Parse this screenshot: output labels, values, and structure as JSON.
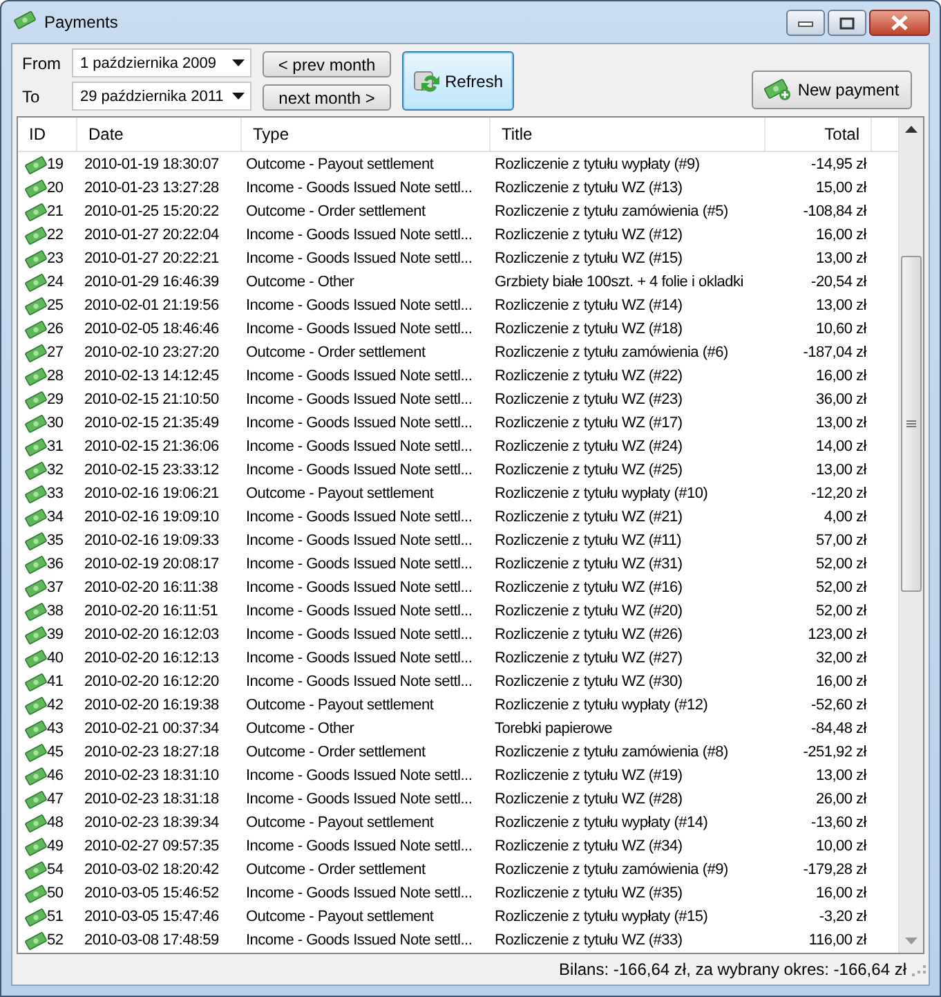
{
  "window": {
    "title": "Payments"
  },
  "filters": [
    {
      "label": "From",
      "value": "1 października 2009"
    },
    {
      "label": "To",
      "value": "29 października 2011"
    }
  ],
  "nav_buttons": [
    "< prev month",
    "next month >"
  ],
  "refresh_button": "Refresh",
  "new_payment_button": "New payment",
  "table": {
    "columns": [
      "ID",
      "Date",
      "Type",
      "Title",
      "Total"
    ],
    "rows": [
      [
        "19",
        "2010-01-19 18:30:07",
        "Outcome - Payout settlement",
        "Rozliczenie z tytułu wypłaty (#9)",
        "-14,95 zł"
      ],
      [
        "20",
        "2010-01-23 13:27:28",
        "Income - Goods Issued Note settl...",
        "Rozliczenie z tytułu WZ (#13)",
        "15,00 zł"
      ],
      [
        "21",
        "2010-01-25 15:20:22",
        "Outcome - Order settlement",
        "Rozliczenie z tytułu zamówienia (#5)",
        "-108,84 zł"
      ],
      [
        "22",
        "2010-01-27 20:22:04",
        "Income - Goods Issued Note settl...",
        "Rozliczenie z tytułu WZ (#12)",
        "16,00 zł"
      ],
      [
        "23",
        "2010-01-27 20:22:21",
        "Income - Goods Issued Note settl...",
        "Rozliczenie z tytułu WZ (#15)",
        "13,00 zł"
      ],
      [
        "24",
        "2010-01-29 16:46:39",
        "Outcome - Other",
        "Grzbiety białe 100szt. + 4 folie i okladki",
        "-20,54 zł"
      ],
      [
        "25",
        "2010-02-01 21:19:56",
        "Income - Goods Issued Note settl...",
        "Rozliczenie z tytułu WZ (#14)",
        "13,00 zł"
      ],
      [
        "26",
        "2010-02-05 18:46:46",
        "Income - Goods Issued Note settl...",
        "Rozliczenie z tytułu WZ (#18)",
        "10,60 zł"
      ],
      [
        "27",
        "2010-02-10 23:27:20",
        "Outcome - Order settlement",
        "Rozliczenie z tytułu zamówienia (#6)",
        "-187,04 zł"
      ],
      [
        "28",
        "2010-02-13 14:12:45",
        "Income - Goods Issued Note settl...",
        "Rozliczenie z tytułu WZ (#22)",
        "16,00 zł"
      ],
      [
        "29",
        "2010-02-15 21:10:50",
        "Income - Goods Issued Note settl...",
        "Rozliczenie z tytułu WZ (#23)",
        "36,00 zł"
      ],
      [
        "30",
        "2010-02-15 21:35:49",
        "Income - Goods Issued Note settl...",
        "Rozliczenie z tytułu WZ (#17)",
        "13,00 zł"
      ],
      [
        "31",
        "2010-02-15 21:36:06",
        "Income - Goods Issued Note settl...",
        "Rozliczenie z tytułu WZ (#24)",
        "14,00 zł"
      ],
      [
        "32",
        "2010-02-15 23:33:12",
        "Income - Goods Issued Note settl...",
        "Rozliczenie z tytułu WZ (#25)",
        "13,00 zł"
      ],
      [
        "33",
        "2010-02-16 19:06:21",
        "Outcome - Payout settlement",
        "Rozliczenie z tytułu wypłaty (#10)",
        "-12,20 zł"
      ],
      [
        "34",
        "2010-02-16 19:09:10",
        "Income - Goods Issued Note settl...",
        "Rozliczenie z tytułu WZ (#21)",
        "4,00 zł"
      ],
      [
        "35",
        "2010-02-16 19:09:33",
        "Income - Goods Issued Note settl...",
        "Rozliczenie z tytułu WZ (#11)",
        "57,00 zł"
      ],
      [
        "36",
        "2010-02-19 20:08:17",
        "Income - Goods Issued Note settl...",
        "Rozliczenie z tytułu WZ (#31)",
        "52,00 zł"
      ],
      [
        "37",
        "2010-02-20 16:11:38",
        "Income - Goods Issued Note settl...",
        "Rozliczenie z tytułu WZ (#16)",
        "52,00 zł"
      ],
      [
        "38",
        "2010-02-20 16:11:51",
        "Income - Goods Issued Note settl...",
        "Rozliczenie z tytułu WZ (#20)",
        "52,00 zł"
      ],
      [
        "39",
        "2010-02-20 16:12:03",
        "Income - Goods Issued Note settl...",
        "Rozliczenie z tytułu WZ (#26)",
        "123,00 zł"
      ],
      [
        "40",
        "2010-02-20 16:12:13",
        "Income - Goods Issued Note settl...",
        "Rozliczenie z tytułu WZ (#27)",
        "32,00 zł"
      ],
      [
        "41",
        "2010-02-20 16:12:20",
        "Income - Goods Issued Note settl...",
        "Rozliczenie z tytułu WZ (#30)",
        "16,00 zł"
      ],
      [
        "42",
        "2010-02-20 16:19:38",
        "Outcome - Payout settlement",
        "Rozliczenie z tytułu wypłaty (#12)",
        "-52,60 zł"
      ],
      [
        "43",
        "2010-02-21 00:37:34",
        "Outcome - Other",
        "Torebki papierowe",
        "-84,48 zł"
      ],
      [
        "45",
        "2010-02-23 18:27:18",
        "Outcome - Order settlement",
        "Rozliczenie z tytułu zamówienia (#8)",
        "-251,92 zł"
      ],
      [
        "46",
        "2010-02-23 18:31:10",
        "Income - Goods Issued Note settl...",
        "Rozliczenie z tytułu WZ (#19)",
        "13,00 zł"
      ],
      [
        "47",
        "2010-02-23 18:31:18",
        "Income - Goods Issued Note settl...",
        "Rozliczenie z tytułu WZ (#28)",
        "26,00 zł"
      ],
      [
        "48",
        "2010-02-23 18:39:34",
        "Outcome - Payout settlement",
        "Rozliczenie z tytułu wypłaty (#14)",
        "-13,60 zł"
      ],
      [
        "49",
        "2010-02-27 09:57:35",
        "Income - Goods Issued Note settl...",
        "Rozliczenie z tytułu WZ (#34)",
        "10,00 zł"
      ],
      [
        "54",
        "2010-03-02 18:20:42",
        "Outcome - Order settlement",
        "Rozliczenie z tytułu zamówienia (#9)",
        "-179,28 zł"
      ],
      [
        "50",
        "2010-03-05 15:46:52",
        "Income - Goods Issued Note settl...",
        "Rozliczenie z tytułu WZ (#35)",
        "16,00 zł"
      ],
      [
        "51",
        "2010-03-05 15:47:46",
        "Outcome - Payout settlement",
        "Rozliczenie z tytułu wypłaty (#15)",
        "-3,20 zł"
      ],
      [
        "52",
        "2010-03-08 17:48:59",
        "Income - Goods Issued Note settl...",
        "Rozliczenie z tytułu WZ (#33)",
        "116,00 zł"
      ]
    ]
  },
  "status_bar": "Bilans: -166,64 zł, za wybrany okres: -166,64 zł"
}
